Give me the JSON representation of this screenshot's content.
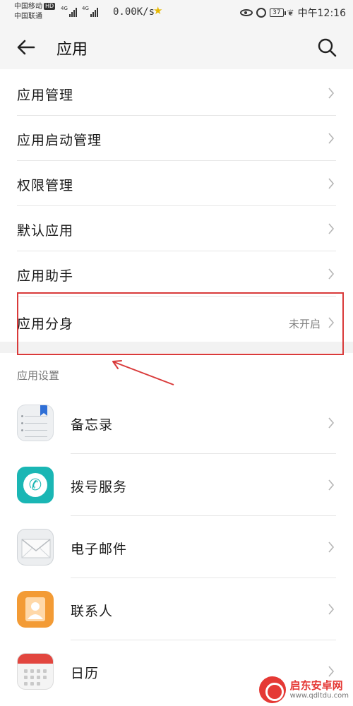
{
  "status_bar": {
    "carrier1": "中国移动",
    "carrier1_badge": "HD",
    "carrier2": "中国联通",
    "net1": "4G",
    "net2": "4G",
    "speed": "0.00K/s",
    "battery": "37",
    "time": "中午12:16"
  },
  "header": {
    "title": "应用"
  },
  "menu": [
    {
      "label": "应用管理"
    },
    {
      "label": "应用启动管理"
    },
    {
      "label": "权限管理"
    },
    {
      "label": "默认应用"
    },
    {
      "label": "应用助手"
    },
    {
      "label": "应用分身",
      "value": "未开启"
    }
  ],
  "section_title": "应用设置",
  "apps": [
    {
      "label": "备忘录",
      "icon": "memo-icon"
    },
    {
      "label": "拨号服务",
      "icon": "phone-icon"
    },
    {
      "label": "电子邮件",
      "icon": "mail-icon"
    },
    {
      "label": "联系人",
      "icon": "contacts-icon"
    },
    {
      "label": "日历",
      "icon": "calendar-icon"
    }
  ],
  "watermark": {
    "line1": "启东安卓网",
    "line2": "www.qdltdu.com"
  },
  "colors": {
    "highlight": "#d93a3a",
    "phone": "#1ab6b4",
    "contacts": "#f39b35",
    "calendar": "#e2463f"
  }
}
